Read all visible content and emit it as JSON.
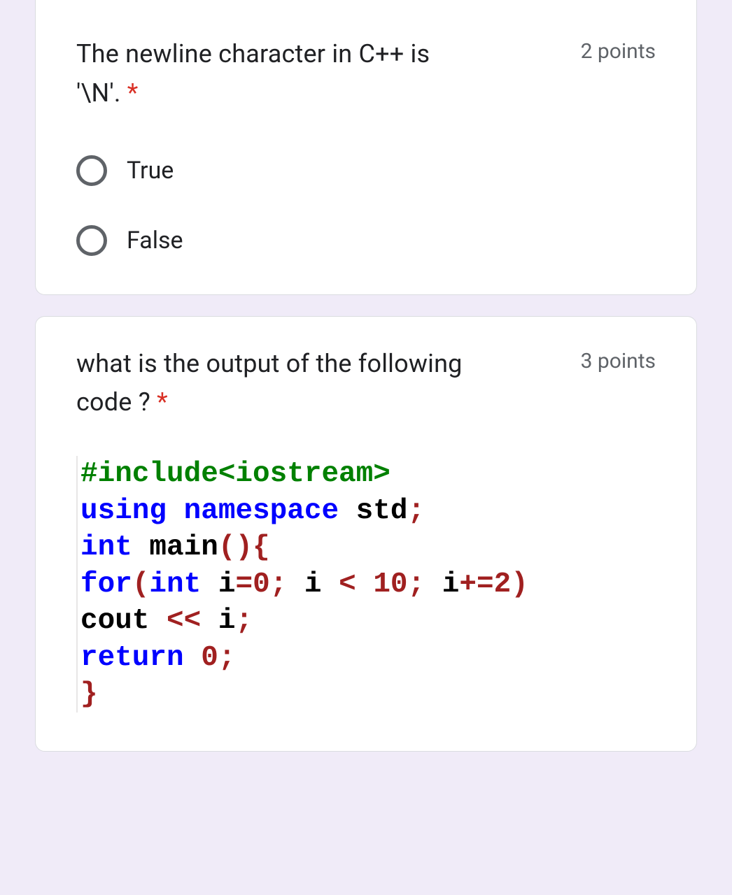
{
  "q1": {
    "text_line1": "The newline character in C++ is",
    "text_line2": "'\\N'.",
    "required": "*",
    "points": "2 points",
    "options": [
      "True",
      "False"
    ]
  },
  "q2": {
    "text_line1": "what is the output of the following",
    "text_line2": "code ?",
    "required": "*",
    "points": "3 points",
    "code": {
      "l1_a": "#include<iostream>",
      "l2_a": "using",
      "l2_b": " ",
      "l2_c": "namespace",
      "l2_d": " std",
      "l2_e": ";",
      "l3_a": "int",
      "l3_b": " main",
      "l3_c": "(){",
      "l4_a": "for",
      "l4_b": "(",
      "l4_c": "int",
      "l4_d": " i",
      "l4_e": "=",
      "l4_f": "0",
      "l4_g": ";",
      "l4_h": " i ",
      "l4_i": "<",
      "l4_j": " ",
      "l4_k": "10",
      "l4_l": ";",
      "l4_m": " i",
      "l4_n": "+=",
      "l4_o": "2",
      "l4_p": ")",
      "l5_a": "cout ",
      "l5_b": "<<",
      "l5_c": " i",
      "l5_d": ";",
      "l6_a": "return",
      "l6_b": " ",
      "l6_c": "0",
      "l6_d": ";",
      "l7_a": "}"
    }
  }
}
